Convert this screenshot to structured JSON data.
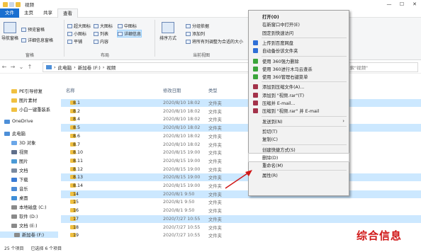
{
  "window": {
    "title": "视频"
  },
  "ribbon_tabs": [
    "文件",
    "主页",
    "共享",
    "查看"
  ],
  "ribbon": {
    "nav_pane": "导航窗格",
    "preview_pane": "预览窗格",
    "details_pane": "详细信息窗格",
    "pane_group": "窗格",
    "extra_large": "超大图标",
    "large": "大图标",
    "medium": "中图标",
    "small": "小图标",
    "list": "列表",
    "details": "详细信息",
    "tiles": "平铺",
    "content": "内容",
    "layout_group": "布局",
    "sort_by": "排序方式",
    "group_by": "分组依据",
    "add_columns": "添加列",
    "fit_columns": "将所有列调整为合适的大小",
    "current_view_group": "当前视图"
  },
  "address": {
    "path": [
      "此电脑",
      "新加卷 (F:)",
      "视频"
    ],
    "search_placeholder": "搜索\"视频\""
  },
  "nav_pane": [
    {
      "label": "PE引导修复"
    },
    {
      "label": "图片素材"
    },
    {
      "label": "小白一键重装系"
    },
    {
      "label": "OneDrive"
    },
    {
      "label": "此电脑"
    },
    {
      "label": "3D 对象"
    },
    {
      "label": "视频"
    },
    {
      "label": "图片"
    },
    {
      "label": "文档"
    },
    {
      "label": "下载"
    },
    {
      "label": "音乐"
    },
    {
      "label": "桌面"
    },
    {
      "label": "本地磁盘 (C:)"
    },
    {
      "label": "软件 (D:)"
    },
    {
      "label": "文档 (E:)"
    },
    {
      "label": "新加卷 (F:)"
    }
  ],
  "columns": {
    "name": "名称",
    "date": "修改日期",
    "type": "类型"
  },
  "files": [
    {
      "name": "8.1",
      "date": "2020/8/10 18:02",
      "type": "文件夹",
      "sel": true
    },
    {
      "name": "8.2",
      "date": "2020/8/10 18:02",
      "type": "文件夹",
      "sel": false
    },
    {
      "name": "8.4",
      "date": "2020/8/10 18:02",
      "type": "文件夹",
      "sel": false
    },
    {
      "name": "8.5",
      "date": "2020/8/10 18:02",
      "type": "文件夹",
      "sel": true
    },
    {
      "name": "8.6",
      "date": "2020/8/10 18:02",
      "type": "文件夹",
      "sel": false
    },
    {
      "name": "8.7",
      "date": "2020/8/10 18:02",
      "type": "文件夹",
      "sel": false
    },
    {
      "name": "8.10",
      "date": "2020/8/15 19:00",
      "type": "文件夹",
      "sel": false
    },
    {
      "name": "8.11",
      "date": "2020/8/15 19:00",
      "type": "文件夹",
      "sel": false
    },
    {
      "name": "8.12",
      "date": "2020/8/15 19:00",
      "type": "文件夹",
      "sel": false
    },
    {
      "name": "8.13",
      "date": "2020/8/15 19:00",
      "type": "文件夹",
      "sel": true
    },
    {
      "name": "8.14",
      "date": "2020/8/15 19:00",
      "type": "文件夹",
      "sel": false
    },
    {
      "name": "14",
      "date": "2020/8/1 9:50",
      "type": "文件夹",
      "sel": true
    },
    {
      "name": "15",
      "date": "2020/8/1 9:50",
      "type": "文件夹",
      "sel": false
    },
    {
      "name": "16",
      "date": "2020/8/1 9:50",
      "type": "文件夹",
      "sel": false
    },
    {
      "name": "17",
      "date": "2020/7/27 10:55",
      "type": "文件夹",
      "sel": true
    },
    {
      "name": "18",
      "date": "2020/7/27 10:55",
      "type": "文件夹",
      "sel": false
    },
    {
      "name": "19",
      "date": "2020/7/27 10:55",
      "type": "文件夹",
      "sel": false
    }
  ],
  "status": {
    "count": "25 个项目",
    "selected": "已选择 6 个项目"
  },
  "context_menu": [
    {
      "label": "打开(O)",
      "bold": true
    },
    {
      "label": "在新窗口中打开(E)"
    },
    {
      "label": "固定到快速访问"
    },
    {
      "sep": true
    },
    {
      "label": "上传到百度网盘",
      "icon": "#2f6fd6"
    },
    {
      "label": "自动备份该文件夹",
      "icon": "#2f6fd6"
    },
    {
      "sep": true
    },
    {
      "label": "使用 360强力删除",
      "icon": "#3ba53b"
    },
    {
      "label": "使用 360进行木马云查杀",
      "icon": "#3ba53b"
    },
    {
      "label": "使用 360管理右键菜单",
      "icon": "#3ba53b"
    },
    {
      "sep": true
    },
    {
      "label": "添加到压缩文件(A)...",
      "icon": "#a3324a"
    },
    {
      "label": "添加到 \"视频.rar\"(T)",
      "icon": "#a3324a"
    },
    {
      "label": "压缩并 E-mail...",
      "icon": "#a3324a"
    },
    {
      "label": "压缩到 \"视频.rar\" 并 E-mail",
      "icon": "#a3324a"
    },
    {
      "sep": true
    },
    {
      "label": "发送到(N)",
      "arrow": true
    },
    {
      "sep": true
    },
    {
      "label": "剪切(T)"
    },
    {
      "label": "复制(C)"
    },
    {
      "sep": true
    },
    {
      "label": "创建快捷方式(S)"
    },
    {
      "label": "删除(D)",
      "highlight": true
    },
    {
      "label": "重命名(M)"
    },
    {
      "sep": true
    },
    {
      "label": "属性(R)"
    }
  ],
  "watermark": "综合信息"
}
